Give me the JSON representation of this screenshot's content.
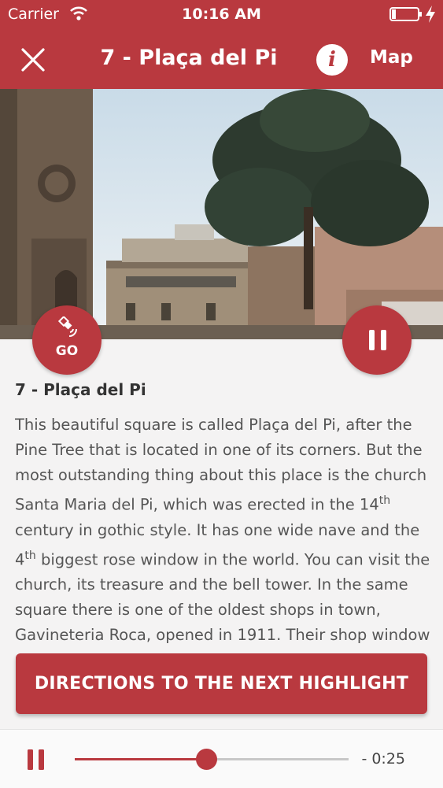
{
  "status_bar": {
    "carrier": "Carrier",
    "time": "10:16 AM"
  },
  "nav": {
    "title": "7 - Plaça del Pi",
    "info_glyph": "i",
    "map_label": "Map",
    "icons": [
      "close-icon",
      "info-icon"
    ]
  },
  "fabs": {
    "go_label": "GO",
    "go_icon": "satellite-icon",
    "pause_icon": "pause-icon"
  },
  "content": {
    "heading": "7 - Plaça del Pi",
    "paragraph": {
      "p1": "This beautiful square is called Plaça del Pi, after the Pine Tree that is located in one of its corners. But the most outstanding thing about this place is the church Santa Maria del Pi, which was erected in the 14",
      "sup1": "th",
      "p2": " century in gothic style. It has one wide nave and the 4",
      "sup2": "th",
      "p3": " biggest rose window in the world. You can visit the church, its treasure and the bell tower. In the same square there is one of the oldest shops in town, Gavineteria Roca, opened in 1911. Their shop window is a work of art."
    }
  },
  "directions_button": {
    "label": "DIRECTIONS TO THE NEXT HIGHLIGHT"
  },
  "player": {
    "remaining": "- 0:25",
    "progress": 0.48
  },
  "colors": {
    "brand": "#b9393f",
    "background": "#f4f3f3"
  }
}
